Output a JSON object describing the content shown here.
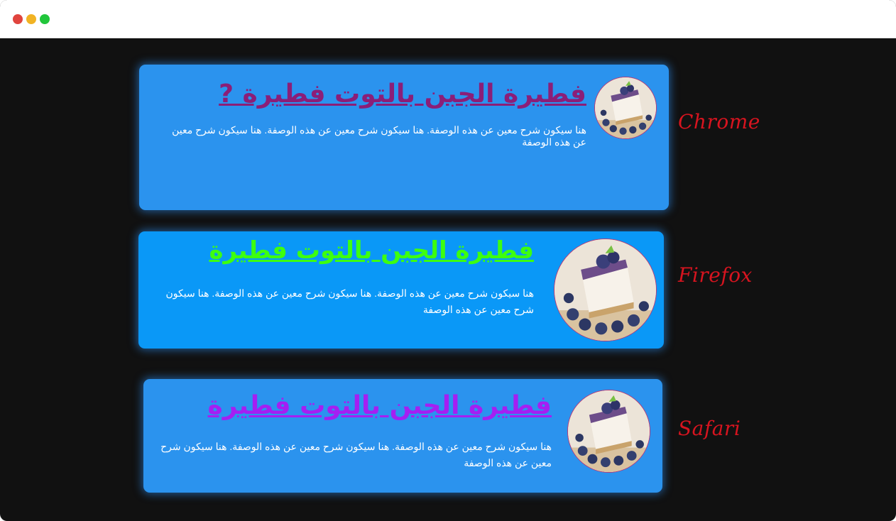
{
  "window": {
    "controls": [
      "close",
      "minimize",
      "maximize"
    ]
  },
  "colors": {
    "background": "#111111",
    "card_chrome": "#2b93ee",
    "card_firefox": "#0a98f7",
    "card_safari": "#2b93ee",
    "title_chrome": "#8b1e78",
    "title_firefox": "#3dff0f",
    "title_safari": "#a51ff2",
    "label": "#d7141f"
  },
  "cards": [
    {
      "browser_label": "Chrome",
      "title": "فطيرة الجبن بالتوت فطيرة ?",
      "description": "هنا سيكون شرح معين عن هذه الوصفة. هنا سيكون شرح معين عن هذه الوصفة. هنا سيكون شرح معين عن هذه الوصفة",
      "image_icon": "blueberry-cheesecake-photo"
    },
    {
      "browser_label": "Firefox",
      "title": "فطيرة الجبن بالتوت فطيرة",
      "description": "هنا سيكون شرح معين عن هذه الوصفة. هنا سيكون شرح معين عن هذه الوصفة. هنا سيكون شرح معين عن هذه الوصفة",
      "image_icon": "blueberry-cheesecake-photo"
    },
    {
      "browser_label": "Safari",
      "title": "فطيرة الجبن بالتوت فطيرة",
      "description": "هنا سيكون شرح معين عن هذه الوصفة. هنا سيكون شرح معين عن هذه الوصفة. هنا سيكون شرح معين عن هذه الوصفة",
      "image_icon": "blueberry-cheesecake-photo"
    }
  ]
}
